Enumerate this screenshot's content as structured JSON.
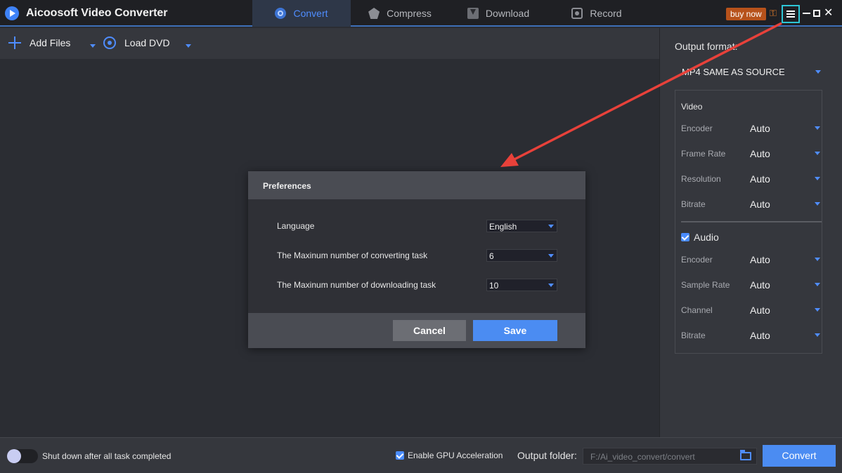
{
  "app": {
    "title": "Aicoosoft Video Converter"
  },
  "tabs": [
    {
      "label": "Convert",
      "icon": "convert-icon",
      "active": true
    },
    {
      "label": "Compress",
      "icon": "compress-icon",
      "active": false
    },
    {
      "label": "Download",
      "icon": "download-icon",
      "active": false
    },
    {
      "label": "Record",
      "icon": "record-icon",
      "active": false
    }
  ],
  "titlebar": {
    "buy_now": "buy now"
  },
  "toolbar": {
    "add_files": "Add Files",
    "load_dvd": "Load DVD"
  },
  "right_panel": {
    "output_format_label": "Output format:",
    "output_format_value": "MP4 SAME AS SOURCE",
    "video_title": "Video",
    "video_rows": [
      {
        "label": "Encoder",
        "value": "Auto"
      },
      {
        "label": "Frame Rate",
        "value": "Auto"
      },
      {
        "label": "Resolution",
        "value": "Auto"
      },
      {
        "label": "Bitrate",
        "value": "Auto"
      }
    ],
    "audio_title": "Audio",
    "audio_checked": true,
    "audio_rows": [
      {
        "label": "Encoder",
        "value": "Auto"
      },
      {
        "label": "Sample Rate",
        "value": "Auto"
      },
      {
        "label": "Channel",
        "value": "Auto"
      },
      {
        "label": "Bitrate",
        "value": "Auto"
      }
    ]
  },
  "dialog": {
    "title": "Preferences",
    "rows": [
      {
        "label": "Language",
        "value": "English"
      },
      {
        "label": "The Maxinum number of converting task",
        "value": "6"
      },
      {
        "label": "The Maxinum number of downloading task",
        "value": "10"
      }
    ],
    "cancel": "Cancel",
    "save": "Save"
  },
  "bottom": {
    "shutdown_label": "Shut down after all task completed",
    "gpu_label": "Enable GPU Acceleration",
    "gpu_checked": true,
    "output_folder_label": "Output folder:",
    "output_folder_value": "F:/Ai_video_convert/convert",
    "convert_button": "Convert"
  },
  "colors": {
    "accent": "#4b8cf2",
    "highlight_box": "#2ec6d6",
    "annotation_arrow": "#e8413a",
    "buy_now_bg": "#b7521b"
  }
}
